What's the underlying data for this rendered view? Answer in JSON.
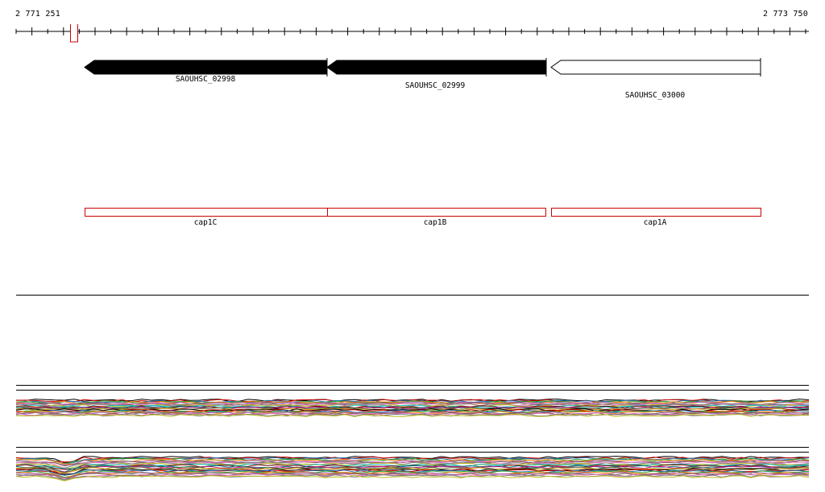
{
  "ruler": {
    "start_label": "2 771 251",
    "end_label": "2 773 750"
  },
  "genes": [
    {
      "label": "SAOUHSC_02998",
      "strand": "-",
      "style": "filled",
      "color": "#000000"
    },
    {
      "label": "SAOUHSC_02999",
      "strand": "-",
      "style": "filled",
      "color": "#000000"
    },
    {
      "label": "SAOUHSC_03000",
      "strand": "-",
      "style": "outline",
      "color": "#000000"
    }
  ],
  "features": [
    {
      "label": "cap1C",
      "color": "#cc0000"
    },
    {
      "label": "cap1B",
      "color": "#cc0000"
    },
    {
      "label": "cap1A",
      "color": "#cc0000"
    }
  ],
  "colors": {
    "feature": "#cc0000",
    "gene": "#000000",
    "background": "#ffffff"
  }
}
